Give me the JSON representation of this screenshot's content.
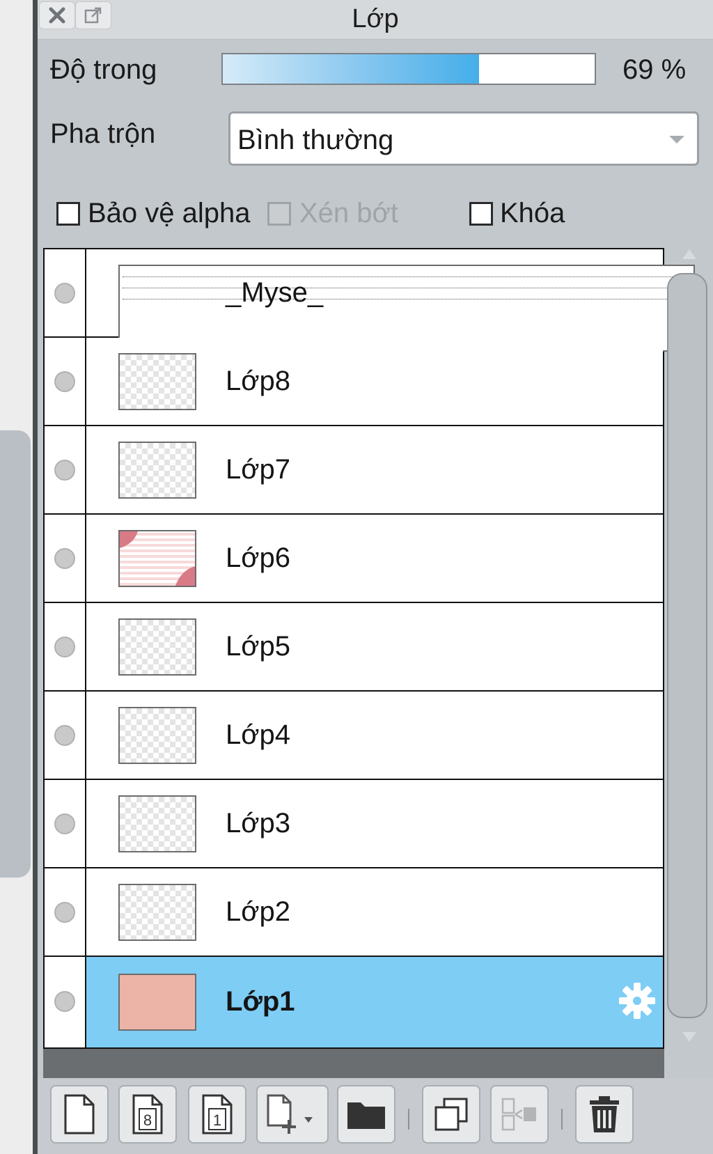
{
  "panel": {
    "title": "Lớp"
  },
  "titlebar": {
    "close_icon": "close-icon",
    "popout_icon": "popout-icon"
  },
  "opacity": {
    "label": "Độ trong",
    "value": 69,
    "display": "69 %"
  },
  "blend": {
    "label": "Pha trộn",
    "value": "Bình thường"
  },
  "options": {
    "alpha_protect": {
      "label": "Bảo vệ alpha",
      "checked": false,
      "enabled": true
    },
    "clipping": {
      "label": "Xén bớt",
      "checked": false,
      "enabled": false
    },
    "lock": {
      "label": "Khóa",
      "checked": false,
      "enabled": true
    }
  },
  "layers": [
    {
      "name": "_Myse_",
      "thumb": "text"
    },
    {
      "name": "Lớp8",
      "thumb": "transparent"
    },
    {
      "name": "Lớp7",
      "thumb": "transparent"
    },
    {
      "name": "Lớp6",
      "thumb": "pattern"
    },
    {
      "name": "Lớp5",
      "thumb": "transparent"
    },
    {
      "name": "Lớp4",
      "thumb": "transparent"
    },
    {
      "name": "Lớp3",
      "thumb": "transparent"
    },
    {
      "name": "Lớp2",
      "thumb": "transparent"
    },
    {
      "name": "Lớp1",
      "thumb": "solid",
      "selected": true,
      "settings_icon": "gear-icon"
    }
  ],
  "colors": {
    "selected_row": "#7ecdf5",
    "layer1_thumb": "#ebb4a6",
    "opacity_fill": "#45aee9"
  },
  "toolbar": {
    "icons": [
      "new-layer-icon",
      "new-8bit-layer-icon",
      "new-1bit-layer-icon",
      "add-layer-menu-icon",
      "new-folder-icon",
      "duplicate-layer-icon",
      "merge-down-icon",
      "delete-layer-icon"
    ],
    "bit8_label": "8",
    "bit1_label": "1"
  }
}
